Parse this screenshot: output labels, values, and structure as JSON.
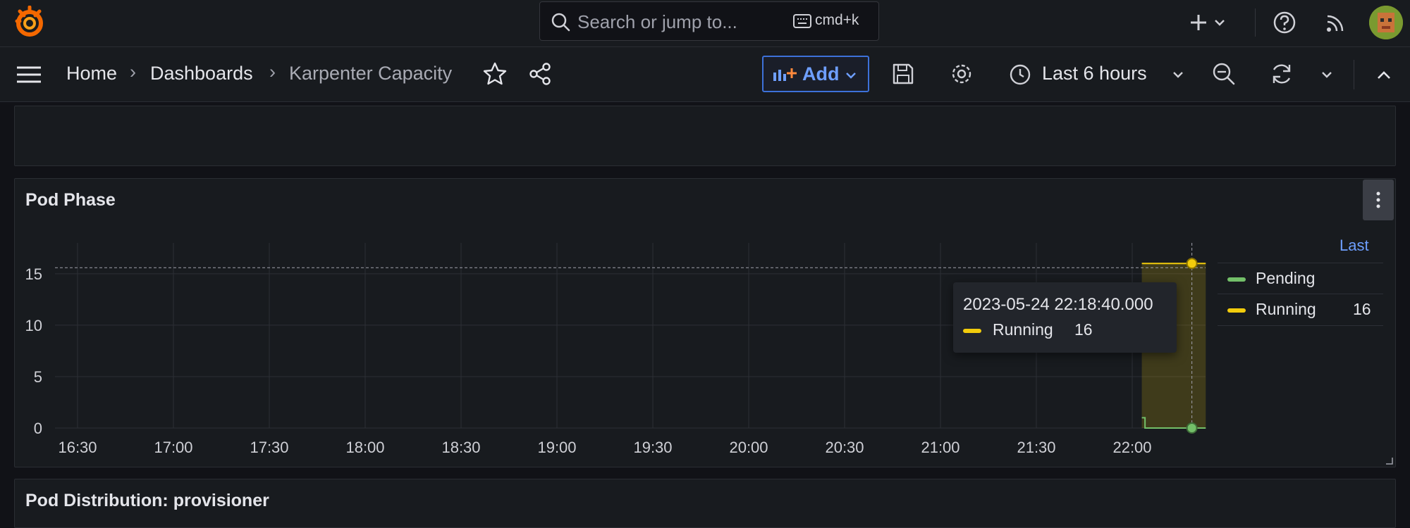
{
  "topbar": {
    "search_placeholder": "Search or jump to...",
    "shortcut": "cmd+k"
  },
  "breadcrumb": [
    "Home",
    "Dashboards",
    "Karpenter Capacity"
  ],
  "toolbar": {
    "add_label": "Add",
    "time_range": "Last 6 hours"
  },
  "panels": {
    "pod_phase_title": "Pod Phase",
    "pod_distribution_title": "Pod Distribution: provisioner"
  },
  "legend": {
    "header": "Last",
    "items": [
      {
        "name": "Pending",
        "value": "",
        "color": "#73bf69"
      },
      {
        "name": "Running",
        "value": "16",
        "color": "#f2cc0c"
      }
    ]
  },
  "tooltip": {
    "time": "2023-05-24 22:18:40.000",
    "series": "Running",
    "value": "16"
  },
  "chart_data": {
    "type": "line",
    "title": "Pod Phase",
    "x_ticks": [
      "16:30",
      "17:00",
      "17:30",
      "18:00",
      "18:30",
      "19:00",
      "19:30",
      "20:00",
      "20:30",
      "21:00",
      "21:30",
      "22:00"
    ],
    "y_ticks": [
      0,
      5,
      10,
      15
    ],
    "ylim": [
      0,
      18
    ],
    "grid": true,
    "legend_placement": "right",
    "series": [
      {
        "name": "Pending",
        "color": "#73bf69",
        "x": [
          "22:03",
          "22:04",
          "22:18",
          "22:23"
        ],
        "values": [
          1,
          0,
          0,
          0
        ]
      },
      {
        "name": "Running",
        "color": "#f2cc0c",
        "x": [
          "22:03",
          "22:18",
          "22:23"
        ],
        "values": [
          16,
          16,
          16
        ]
      }
    ],
    "hover": {
      "x": "22:18:40",
      "y": 16
    }
  }
}
